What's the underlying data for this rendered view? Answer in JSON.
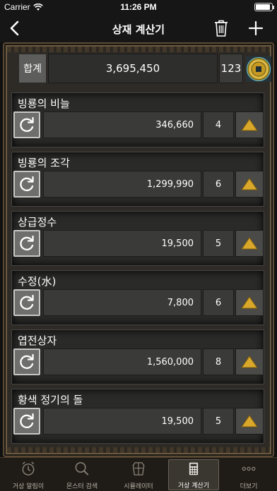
{
  "status": {
    "carrier": "Carrier",
    "time": "11:26 PM"
  },
  "navbar": {
    "title": "상재 계산기"
  },
  "total": {
    "label": "합계",
    "value": "3,695,450",
    "count": "123"
  },
  "items": [
    {
      "name": "빙룡의 비늘",
      "price": "346,660",
      "qty": "4"
    },
    {
      "name": "빙룡의 조각",
      "price": "1,299,990",
      "qty": "6"
    },
    {
      "name": "상급정수",
      "price": "19,500",
      "qty": "5"
    },
    {
      "name": "수정(水)",
      "price": "7,800",
      "qty": "6"
    },
    {
      "name": "엽전상자",
      "price": "1,560,000",
      "qty": "8"
    },
    {
      "name": "황색 정기의 돌",
      "price": "19,500",
      "qty": "5"
    }
  ],
  "tabs": [
    {
      "label": "거상 알림이",
      "icon": "alarm-clock-icon",
      "active": false
    },
    {
      "label": "몬스터 검색",
      "icon": "magnifier-icon",
      "active": false
    },
    {
      "label": "시뮬레이터",
      "icon": "armor-icon",
      "active": false
    },
    {
      "label": "거상 계산기",
      "icon": "calculator-icon",
      "active": true
    },
    {
      "label": "더보기",
      "icon": "more-icon",
      "active": false
    }
  ],
  "colors": {
    "accent_gold": "#d9a82a",
    "frame_bronze": "#6c5a40"
  }
}
